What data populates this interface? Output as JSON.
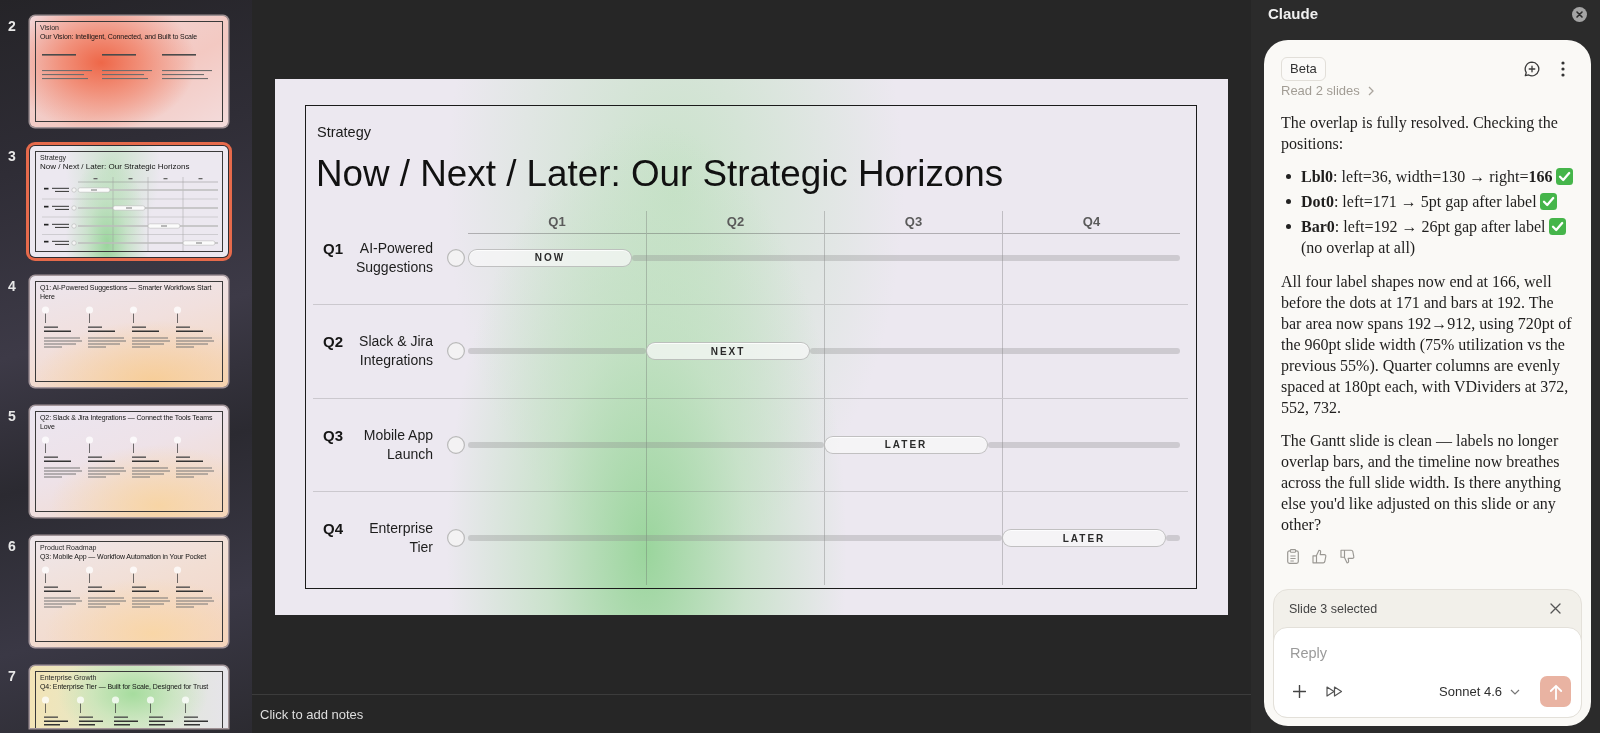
{
  "sidebar": {
    "slides": [
      {
        "number": "2",
        "selected": false,
        "kind": "cards",
        "kicker": "Vision",
        "title": "Our Vision: Intelligent, Connected, and Built to Scale"
      },
      {
        "number": "3",
        "selected": true,
        "kind": "gantt",
        "kicker": "Strategy",
        "title": "Now / Next / Later: Our Strategic Horizons"
      },
      {
        "number": "4",
        "selected": false,
        "kind": "timeline",
        "title": "Q1: AI-Powered Suggestions — Smarter Workflows Start Here"
      },
      {
        "number": "5",
        "selected": false,
        "kind": "timeline",
        "title": "Q2: Slack & Jira Integrations — Connect the Tools Teams Love"
      },
      {
        "number": "6",
        "selected": false,
        "kind": "timeline",
        "kicker": "Product Roadmap",
        "title": "Q3: Mobile App — Workflow Automation in Your Pocket"
      },
      {
        "number": "7",
        "selected": false,
        "kind": "roadmap",
        "kicker": "Enterprise Growth",
        "title": "Q4: Enterprise Tier — Built for Scale, Designed for Trust"
      }
    ]
  },
  "slide": {
    "kicker": "Strategy",
    "title": "Now / Next / Later: Our Strategic Horizons",
    "quarters": [
      "Q1",
      "Q2",
      "Q3",
      "Q4"
    ],
    "rows": [
      {
        "quarter": "Q1",
        "name": "AI-Powered Suggestions",
        "slots": [
          {
            "kind": "bar",
            "label": "NOW"
          },
          {
            "kind": "empty"
          },
          {
            "kind": "empty"
          },
          {
            "kind": "empty"
          }
        ]
      },
      {
        "quarter": "Q2",
        "name": "Slack & Jira Integrations",
        "slots": [
          {
            "kind": "empty"
          },
          {
            "kind": "bar",
            "label": "NEXT"
          },
          {
            "kind": "empty"
          },
          {
            "kind": "empty"
          }
        ]
      },
      {
        "quarter": "Q3",
        "name": "Mobile App Launch",
        "slots": [
          {
            "kind": "empty"
          },
          {
            "kind": "empty"
          },
          {
            "kind": "bar",
            "label": "LATER"
          },
          {
            "kind": "empty"
          }
        ]
      },
      {
        "quarter": "Q4",
        "name": "Enterprise Tier",
        "slots": [
          {
            "kind": "empty"
          },
          {
            "kind": "empty"
          },
          {
            "kind": "empty"
          },
          {
            "kind": "bar",
            "label": "LATER"
          }
        ]
      }
    ]
  },
  "notes": {
    "placeholder": "Click to add notes"
  },
  "assistant": {
    "title": "Claude",
    "badge": "Beta",
    "activity": "Read 2 slides",
    "message": [
      {
        "kind": "paragraph",
        "text": "The overlap is fully resolved. Checking the positions:"
      },
      {
        "kind": "list",
        "items": [
          {
            "text": "**Lbl0**: left=36, width=130 → right=**166**",
            "passed": true
          },
          {
            "text": "**Dot0**: left=171 → 5pt gap after label",
            "passed": true
          },
          {
            "text": "**Bar0**: left=192 → 26pt gap after label",
            "passed": true,
            "note": "(no overlap at all)"
          }
        ]
      },
      {
        "kind": "paragraph",
        "text": "All four label shapes now end at 166, well before the dots at 171 and bars at 192. The bar area now spans 192→912, using 720pt of the 960pt slide width (75% utilization vs the previous 55%). Quarter columns are evenly spaced at 180pt each, with VDividers at 372, 552, 732."
      },
      {
        "kind": "paragraph",
        "text": "The Gantt slide is clean — labels no longer overlap bars, and the timeline now breathes across the full slide width. Is there anything else you'd like adjusted on this slide or any other?"
      }
    ],
    "context": {
      "label": "Slide 3 selected"
    },
    "composer": {
      "placeholder": "Reply",
      "model": "Sonnet 4.6",
      "send": {
        "disabled": true
      }
    }
  }
}
